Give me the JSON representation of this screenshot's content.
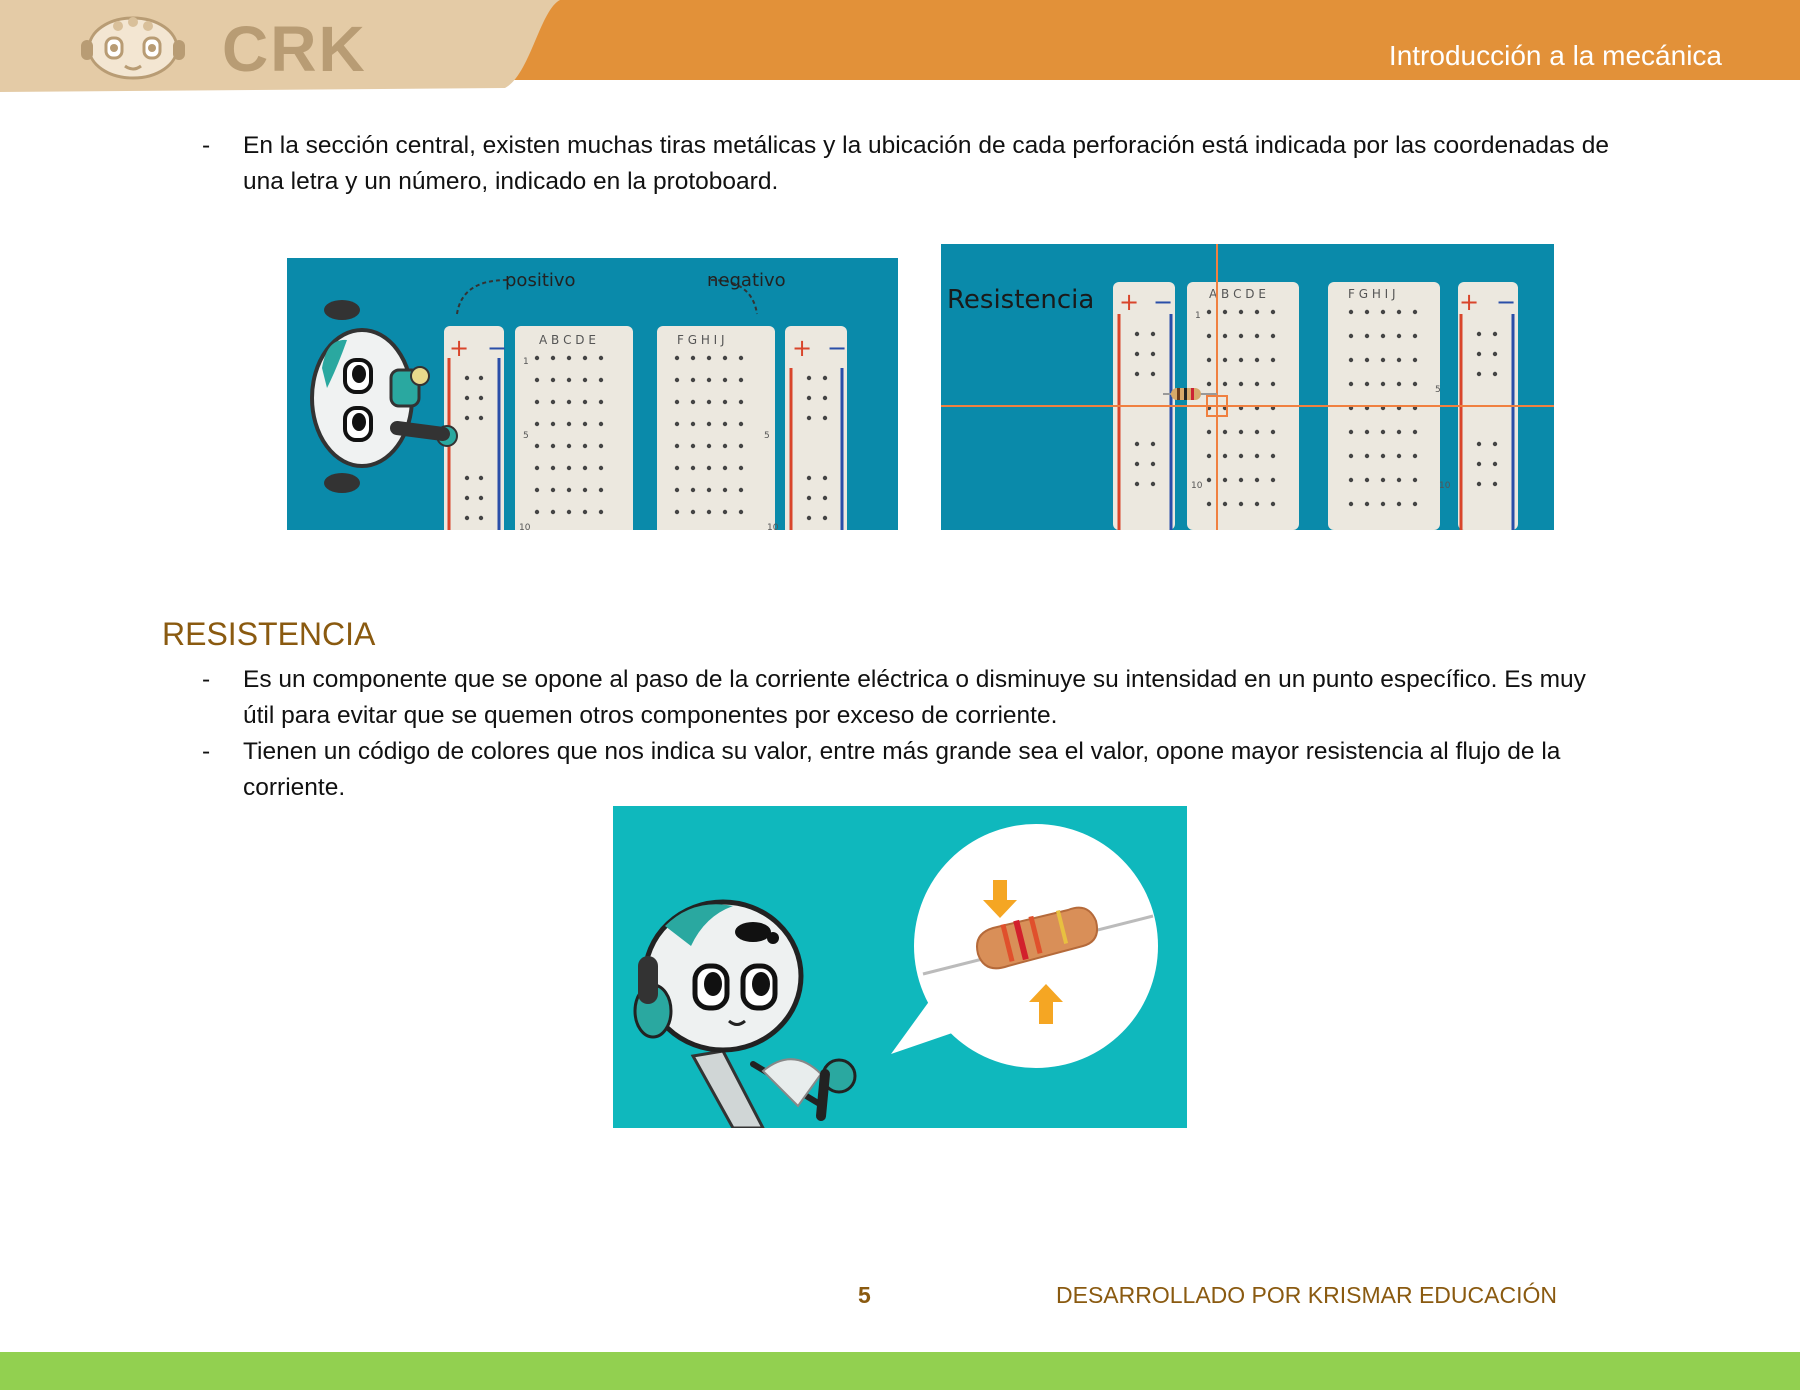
{
  "header": {
    "logo_text": "CRK",
    "title": "Introducción a la mecánica",
    "colors": {
      "bar": "#e29139",
      "logo_panel": "#e4cba6"
    }
  },
  "intro_bullets": [
    {
      "dash": "-",
      "line1": "En la sección central, existen muchas tiras metálicas y la ubicación de cada perforación está indicada por las coordenadas de",
      "line2": "una letra y un número, indicado en la protoboard."
    }
  ],
  "figures": {
    "breadboard_left": {
      "label_positive": "positivo",
      "label_negative": "negativo",
      "plus": "+",
      "minus": "−",
      "cols_left": "A B C D E",
      "cols_right": "F G H I J",
      "row1": "1",
      "row5": "5",
      "row10": "10"
    },
    "breadboard_right": {
      "label": "Resistencia",
      "plus": "+",
      "minus": "−",
      "cols_left": "A B C D E",
      "cols_right": "F G H I J",
      "row1": "1",
      "row5": "5",
      "row10": "10"
    }
  },
  "section": {
    "title": "RESISTENCIA"
  },
  "resistencia_bullets": [
    {
      "dash": "-",
      "line1": "Es un componente que se opone al paso de la corriente eléctrica o disminuye su intensidad en un punto específico. Es muy",
      "line2": "útil para evitar que se quemen otros componentes por exceso de corriente."
    },
    {
      "dash": "-",
      "line1": "Tienen un código de colores que nos indica su valor, entre más grande sea el valor, opone mayor resistencia al flujo de la",
      "line2": "corriente."
    }
  ],
  "footer": {
    "page_number": "5",
    "credit": "DESARROLLADO POR KRISMAR EDUCACIÓN",
    "bar_color": "#92d050"
  }
}
